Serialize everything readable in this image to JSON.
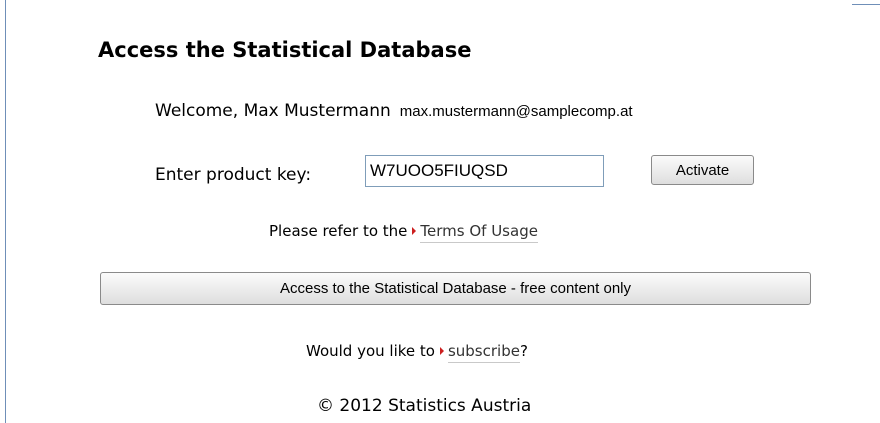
{
  "page": {
    "title": "Access the Statistical Database"
  },
  "welcome": {
    "text": "Welcome, Max Mustermann",
    "email": "max.mustermann@samplecomp.at"
  },
  "product_key": {
    "label": "Enter product key:",
    "value": "W7UOO5FIUQSD",
    "activate_label": "Activate"
  },
  "terms": {
    "prefix": "Please refer to the",
    "link_label": "Terms Of Usage"
  },
  "free_access": {
    "button_label": "Access to the Statistical Database - free content only"
  },
  "subscribe": {
    "prefix": "Would you like to",
    "link_label": "subscribe",
    "suffix": "?"
  },
  "footer": {
    "copyright": "© 2012 Statistics Austria"
  },
  "colors": {
    "link_arrow": "#cc1f1f",
    "frame_edge": "#6f8fb8"
  },
  "icons": {
    "link_arrow": "red-arrow-icon"
  }
}
